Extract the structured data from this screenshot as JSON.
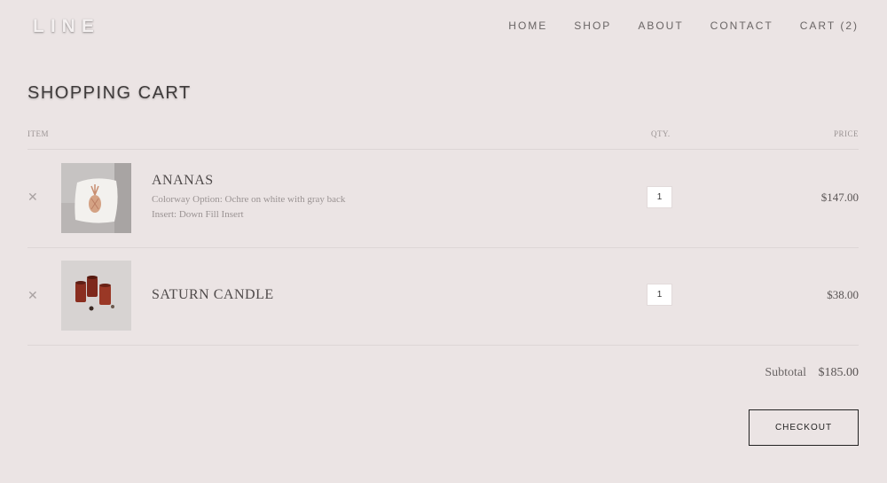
{
  "header": {
    "logo": "LINE",
    "nav": [
      "HOME",
      "SHOP",
      "ABOUT",
      "CONTACT",
      "CART (2)"
    ]
  },
  "cart": {
    "title": "SHOPPING CART",
    "columns": {
      "item": "ITEM",
      "qty": "QTY.",
      "price": "PRICE"
    },
    "items": [
      {
        "name": "ANANAS",
        "options": [
          "Colorway Option: Ochre on white with gray back",
          "Insert: Down Fill Insert"
        ],
        "qty": "1",
        "price": "$147.00",
        "remove_icon": "close-icon"
      },
      {
        "name": "SATURN CANDLE",
        "options": [],
        "qty": "1",
        "price": "$38.00",
        "remove_icon": "close-icon"
      }
    ],
    "subtotal_label": "Subtotal",
    "subtotal_value": "$185.00",
    "checkout_label": "CHECKOUT"
  }
}
